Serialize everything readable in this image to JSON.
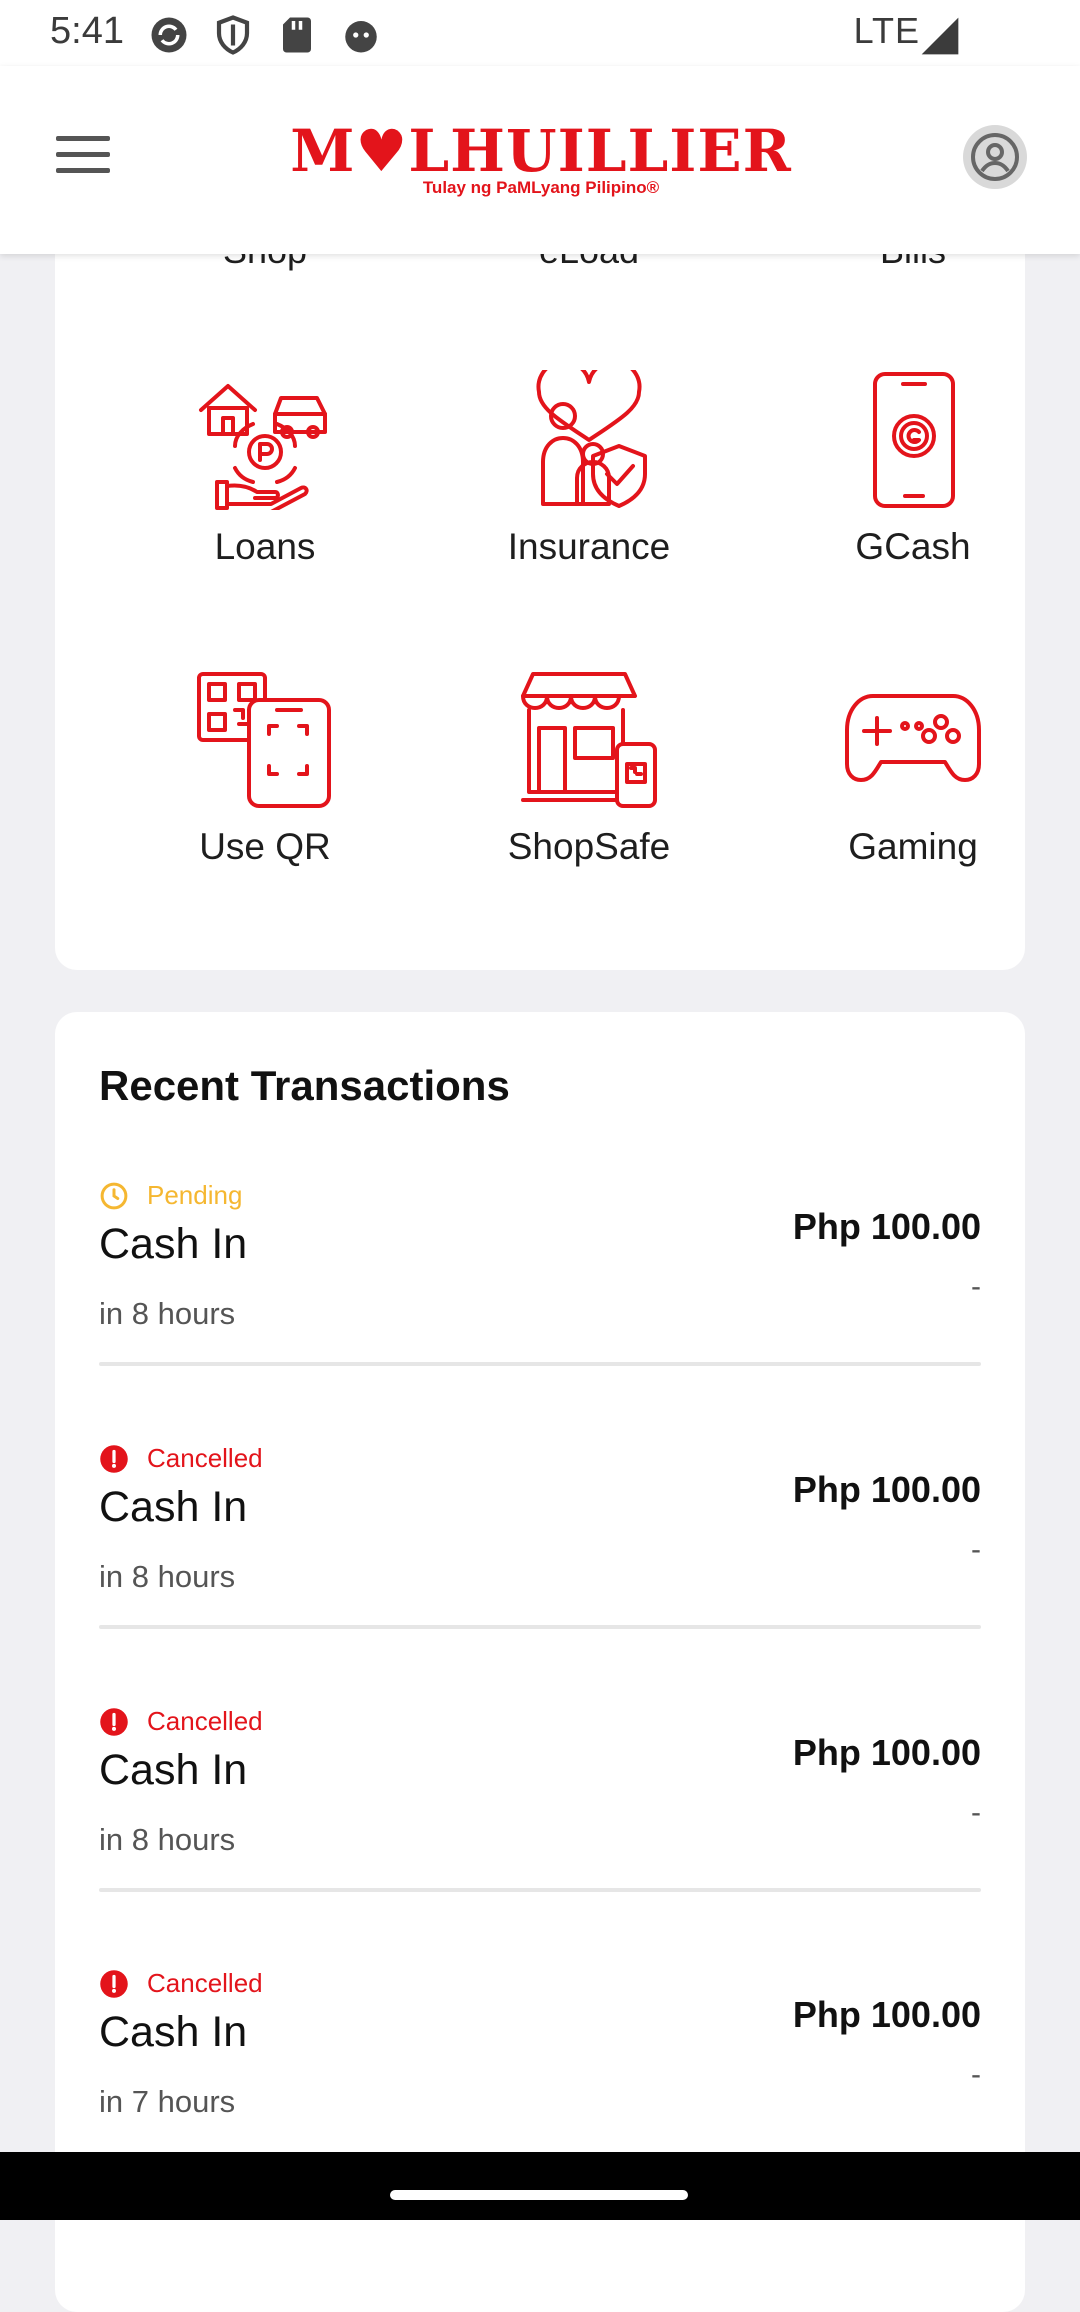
{
  "status_bar": {
    "time": "5:41",
    "network": "LTE"
  },
  "header": {
    "logo_text": "M♥LHUILLIER",
    "logo_tagline": "Tulay ng PaMLyang Pilipino®"
  },
  "services": {
    "cut_row": [
      "Shop",
      "eLoad",
      "Bills"
    ],
    "items": [
      {
        "label": "Loans",
        "icon": "loans-icon"
      },
      {
        "label": "Insurance",
        "icon": "insurance-icon"
      },
      {
        "label": "GCash",
        "icon": "gcash-icon"
      },
      {
        "label": "Use QR",
        "icon": "qr-icon"
      },
      {
        "label": "ShopSafe",
        "icon": "shopsafe-icon"
      },
      {
        "label": "Gaming",
        "icon": "gaming-icon"
      }
    ]
  },
  "transactions": {
    "title": "Recent Transactions",
    "items": [
      {
        "status": "Pending",
        "name": "Cash In",
        "time": "in 8 hours",
        "amount": "Php 100.00",
        "detail": "-"
      },
      {
        "status": "Cancelled",
        "name": "Cash In",
        "time": "in 8 hours",
        "amount": "Php 100.00",
        "detail": "-"
      },
      {
        "status": "Cancelled",
        "name": "Cash In",
        "time": "in 8 hours",
        "amount": "Php 100.00",
        "detail": "-"
      },
      {
        "status": "Cancelled",
        "name": "Cash In",
        "time": "in 7 hours",
        "amount": "Php 100.00",
        "detail": "-"
      }
    ]
  },
  "colors": {
    "brand_red": "#e3141b",
    "pending_amber": "#f5b731",
    "cancelled_red": "#e3141b"
  }
}
